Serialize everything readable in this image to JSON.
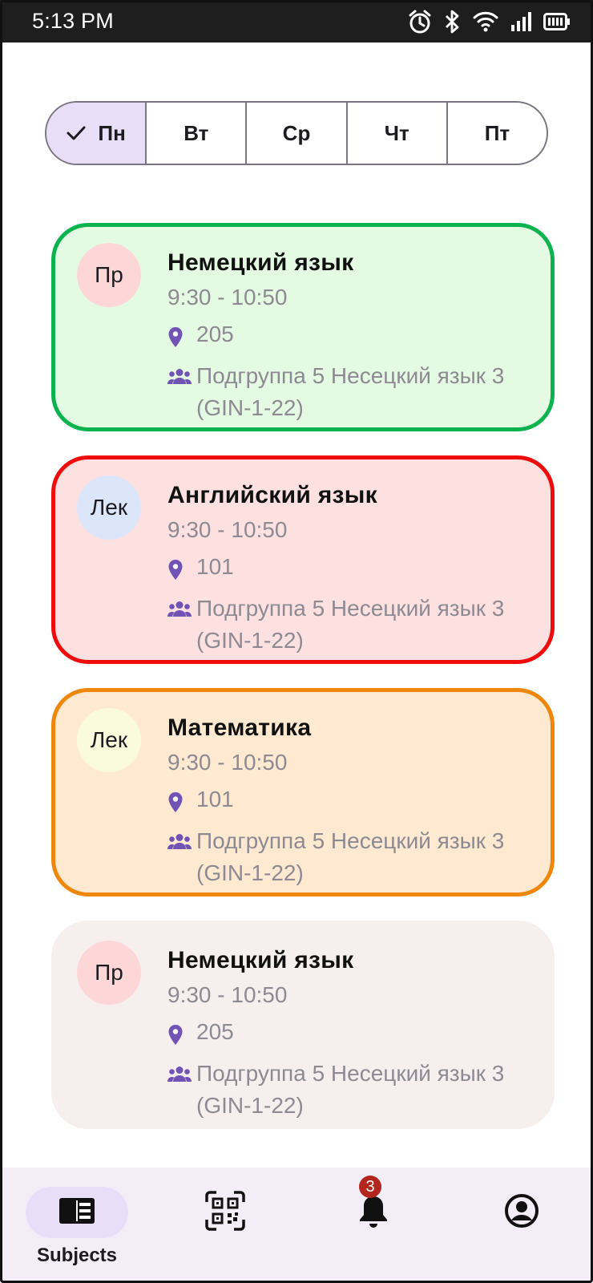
{
  "status_bar": {
    "time": "5:13 PM",
    "icons": [
      "alarm-icon",
      "bluetooth-icon",
      "wifi-icon",
      "cellular-signal-icon",
      "battery-icon"
    ]
  },
  "day_selector": {
    "days": [
      {
        "label": "Пн",
        "selected": true
      },
      {
        "label": "Вт",
        "selected": false
      },
      {
        "label": "Ср",
        "selected": false
      },
      {
        "label": "Чт",
        "selected": false
      },
      {
        "label": "Пт",
        "selected": false
      }
    ]
  },
  "lessons": [
    {
      "badge": "Пр",
      "subject": "Немецкий язык",
      "time": "9:30 - 10:50",
      "room": "205",
      "group_line1": "Подгруппа 5 Несецкий язык 3",
      "group_line2": "(GIN-1-22)",
      "border_color": "#0bb34f",
      "background": "#e4fae2"
    },
    {
      "badge": "Лек",
      "subject": "Английский язык",
      "time": "9:30 - 10:50",
      "room": "101",
      "group_line1": "Подгруппа 5 Несецкий язык 3",
      "group_line2": "(GIN-1-22)",
      "border_color": "#ee0c0c",
      "background": "#fde0e0"
    },
    {
      "badge": "Лек",
      "subject": "Математика",
      "time": "9:30 - 10:50",
      "room": "101",
      "group_line1": "Подгруппа 5 Несецкий язык 3",
      "group_line2": "(GIN-1-22)",
      "border_color": "#ef870d",
      "background": "#ffe9d1"
    },
    {
      "badge": "Пр",
      "subject": "Немецкий язык",
      "time": "9:30 - 10:50",
      "room": "205",
      "group_line1": "Подгруппа 5 Несецкий язык 3",
      "group_line2": "(GIN-1-22)",
      "border_color": "none",
      "background": "#f6efee"
    }
  ],
  "bottom_nav": {
    "subjects_label": "Subjects",
    "notification_count": "3",
    "icons": [
      "subjects-icon",
      "qr-code-icon",
      "bell-icon",
      "account-icon"
    ]
  },
  "colors": {
    "accent": "#7152b5",
    "selected_bg": "#e8def8",
    "nav_bg": "#f3edf7",
    "badge_red": "#b3261e"
  }
}
